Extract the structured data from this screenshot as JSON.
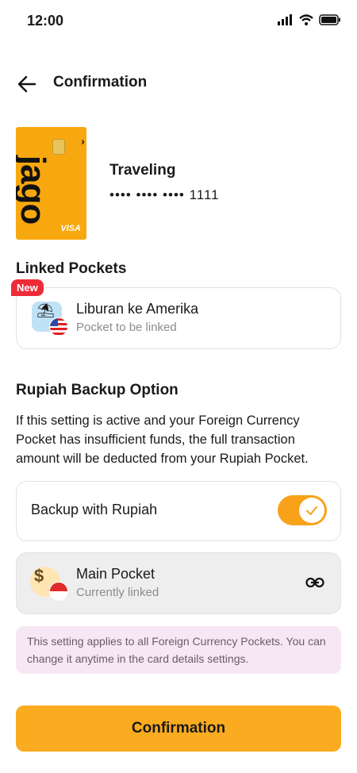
{
  "status_bar": {
    "time": "12:00"
  },
  "header": {
    "title": "Confirmation"
  },
  "card": {
    "brand": "jago",
    "network": "VISA",
    "name": "Traveling",
    "number": "•••• •••• •••• 1111"
  },
  "linked_pockets": {
    "title": "Linked Pockets",
    "badge": "New",
    "pocket": {
      "name": "Liburan ke Amerika",
      "status": "Pocket to be linked"
    }
  },
  "backup": {
    "title": "Rupiah Backup Option",
    "description": "If this setting is active and your Foreign Currency Pocket has insufficient funds, the full transaction amount will be deducted from your Rupiah Pocket.",
    "toggle_label": "Backup with Rupiah",
    "toggle_on": true,
    "main_pocket": {
      "name": "Main Pocket",
      "status": "Currently linked"
    },
    "note": "This setting applies to all Foreign Currency Pockets. You can change it anytime in the card details settings."
  },
  "footer": {
    "confirm_label": "Confirmation"
  },
  "colors": {
    "accent": "#f8a21a",
    "badge": "#ef2b3a",
    "note_bg": "#f7e7f4"
  }
}
